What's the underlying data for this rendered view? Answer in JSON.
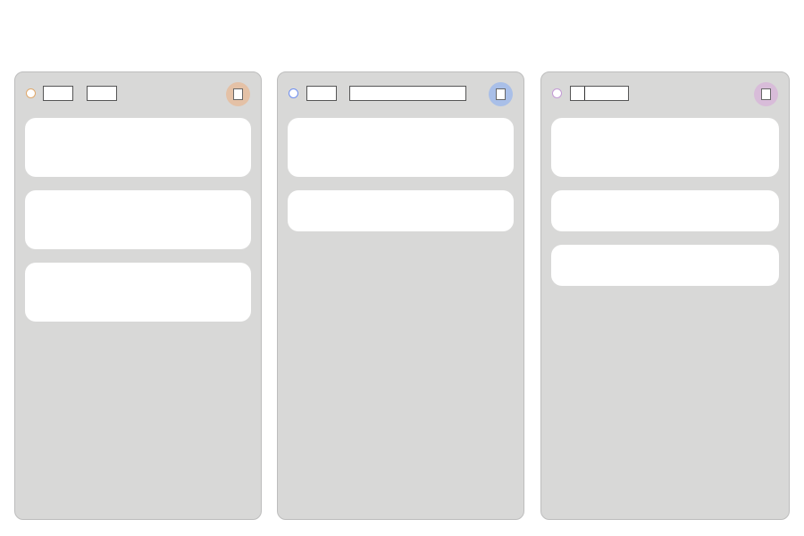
{
  "board": {
    "columns": [
      {
        "id": "column-1",
        "header_fields": [
          "",
          ""
        ],
        "status_color": "#e0a86a",
        "action_color": "#e4c1a6",
        "action_icon": "square-icon",
        "cards": [
          "",
          "",
          ""
        ]
      },
      {
        "id": "column-2",
        "header_fields": [
          "",
          ""
        ],
        "status_color": "#6f8ff0",
        "action_color": "#a9bfe8",
        "action_icon": "square-icon",
        "cards": [
          "",
          ""
        ]
      },
      {
        "id": "column-3",
        "header_fields": [
          ""
        ],
        "status_color": "#c49ad6",
        "action_color": "#d8bcd9",
        "action_icon": "square-icon",
        "cards": [
          "",
          "",
          ""
        ]
      }
    ]
  }
}
